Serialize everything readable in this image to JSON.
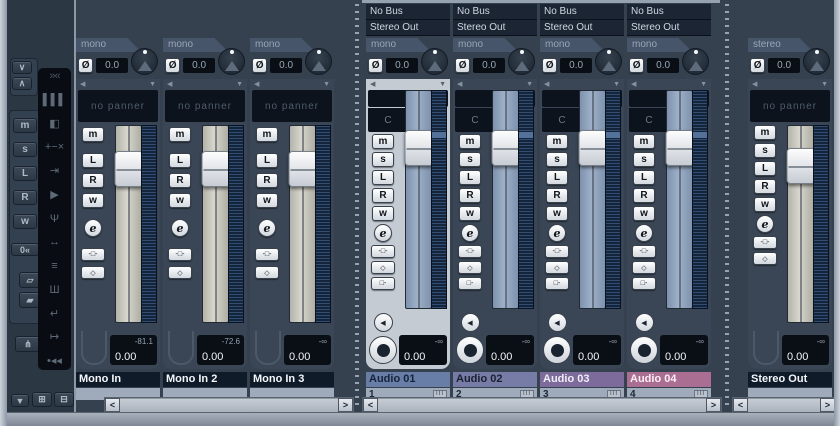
{
  "labels": {
    "phase": "Ø",
    "arrow_left": "◀",
    "arrow_down": "▼",
    "insert_bypass": "-□-",
    "eq_bypass": "◇",
    "sends_bypass": "□-",
    "grid_icon": "III",
    "scroll_left": "<",
    "scroll_right": ">",
    "reset": "0«",
    "collapse_arrow": "▼"
  },
  "left_toolbar": {
    "chevron_down": "∨",
    "chevron_up": "∧",
    "global_buttons": [
      {
        "label": "m"
      },
      {
        "label": "s"
      },
      {
        "label": "L"
      },
      {
        "label": "R"
      },
      {
        "label": "w"
      }
    ],
    "copy_icon": "▱",
    "paste_icon": "▰",
    "routing_icon": "⋔",
    "store_view_icon": "⊞",
    "remove_view_icon": "⊟"
  },
  "common_panel": {
    "icons": [
      {
        "name": "narrow-wide-all",
        "glyph": "»«"
      },
      {
        "name": "mixer-view",
        "glyph": "▌▌▌"
      },
      {
        "name": "window-panes",
        "glyph": "◧"
      },
      {
        "name": "add-subtract",
        "glyph": "+−×"
      },
      {
        "name": "show-input-channels",
        "glyph": "⇥"
      },
      {
        "name": "play-output",
        "glyph": "▶"
      },
      {
        "name": "tuning-fork",
        "glyph": "Ψ"
      },
      {
        "name": "width-arrows",
        "glyph": "↔"
      },
      {
        "name": "level-lines",
        "glyph": "≡"
      },
      {
        "name": "keys",
        "glyph": "Ш"
      },
      {
        "name": "return-arrow",
        "glyph": "↵"
      },
      {
        "name": "exit-arrow",
        "glyph": "↦"
      },
      {
        "name": "dots-rewind",
        "glyph": "•◂◂"
      }
    ]
  },
  "input_section": {
    "buttons": [
      "m",
      "L",
      "R",
      "w",
      "e"
    ],
    "channels": [
      {
        "tab": "mono",
        "gain": "0.0",
        "panner": "no panner",
        "peak": "-81.1",
        "level": "0.00",
        "name": "Mono In"
      },
      {
        "tab": "mono",
        "gain": "0.0",
        "panner": "no panner",
        "peak": "-72.6",
        "level": "0.00",
        "name": "Mono In 2"
      },
      {
        "tab": "mono",
        "gain": "0.0",
        "panner": "no panner",
        "peak": "-∞",
        "level": "0.00",
        "name": "Mono In 3"
      }
    ]
  },
  "audio_section": {
    "buttons": [
      "m",
      "s",
      "L",
      "R",
      "w",
      "e"
    ],
    "channels": [
      {
        "routing_top": "No Bus",
        "routing_bottom": "Stereo Out",
        "tab": "mono",
        "gain": "0.0",
        "pan": "C",
        "peak": "-∞",
        "level": "0.00",
        "name": "Audio 01",
        "number": "1",
        "label_style": "background:#697ea6;color:#16233c"
      },
      {
        "routing_top": "No Bus",
        "routing_bottom": "Stereo Out",
        "tab": "mono",
        "gain": "0.0",
        "pan": "C",
        "peak": "-∞",
        "level": "0.00",
        "name": "Audio 02",
        "number": "2",
        "label_style": "background:#767ca6;color:#1b2030"
      },
      {
        "routing_top": "No Bus",
        "routing_bottom": "Stereo Out",
        "tab": "mono",
        "gain": "0.0",
        "pan": "C",
        "peak": "-∞",
        "level": "0.00",
        "name": "Audio 03",
        "number": "3",
        "label_style": "background:#7c6b9b;color:#f0eef6"
      },
      {
        "routing_top": "No Bus",
        "routing_bottom": "Stereo Out",
        "tab": "mono",
        "gain": "0.0",
        "pan": "C",
        "peak": "-∞",
        "level": "0.00",
        "name": "Audio 04",
        "number": "4",
        "label_style": "background:#aa6e92;color:#fdeef6"
      }
    ]
  },
  "output_section": {
    "buttons": [
      "m",
      "s",
      "L",
      "R",
      "w",
      "e"
    ],
    "channels": [
      {
        "tab": "stereo",
        "gain": "0.0",
        "panner": "no panner",
        "peak": "-∞",
        "level": "0.00",
        "name": "Stereo Out"
      }
    ]
  },
  "colors": {
    "window_bg": "#35414f",
    "selected_strip": "#c5cbd3",
    "meter_bg": "#14243a",
    "pan_tick": "#52d8ea",
    "value_bg": "#0a0f16"
  }
}
